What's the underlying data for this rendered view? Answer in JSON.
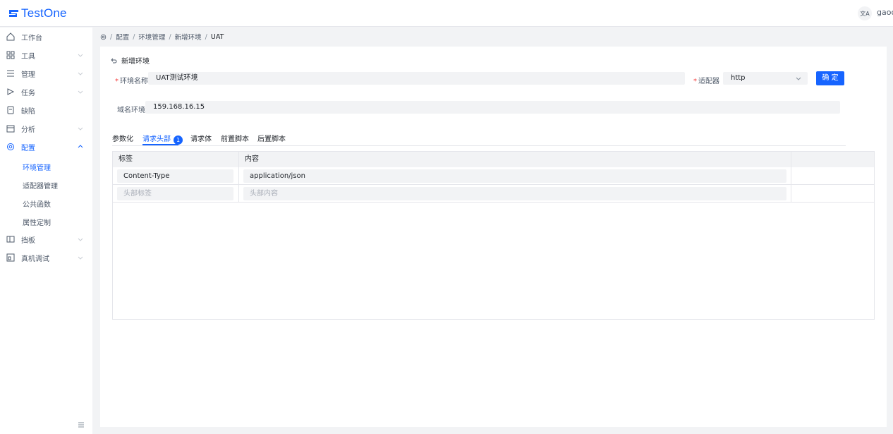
{
  "app": {
    "name": "TestOne",
    "user": "gaoc",
    "lang_icon": "translate-icon"
  },
  "sidebar": {
    "items": [
      {
        "label": "工作台",
        "icon": "home-icon"
      },
      {
        "label": "工具",
        "icon": "grid-icon"
      },
      {
        "label": "管理",
        "icon": "list-icon"
      },
      {
        "label": "任务",
        "icon": "play-icon"
      },
      {
        "label": "缺陷",
        "icon": "bug-icon"
      },
      {
        "label": "分析",
        "icon": "chart-icon"
      },
      {
        "label": "配置",
        "icon": "gear-icon"
      },
      {
        "label": "挡板",
        "icon": "panel-icon"
      },
      {
        "label": "真机调试",
        "icon": "device-icon"
      }
    ],
    "sub_items": [
      "环境管理",
      "适配器管理",
      "公共函数",
      "属性定制"
    ]
  },
  "breadcrumb": {
    "items": [
      "配置",
      "环境管理",
      "新增环境"
    ],
    "current": "UAT"
  },
  "form": {
    "header": "新增环境",
    "env_name_label": "环境名称",
    "env_name_value": "UAT测试环境",
    "adapter_label": "适配器",
    "adapter_value": "http",
    "confirm_label": "确 定",
    "domain_label": "域名环境",
    "domain_value": "159.168.16.15"
  },
  "tabs": {
    "items": [
      "参数化",
      "请求头部",
      "请求体",
      "前置脚本",
      "后置脚本"
    ],
    "active": "请求头部",
    "badge": "1"
  },
  "table": {
    "columns": [
      "标签",
      "内容"
    ],
    "rows": [
      {
        "key": "Content-Type",
        "value": "application/json"
      }
    ],
    "placeholder": {
      "key": "头部标签",
      "value": "头部内容"
    }
  },
  "colors": {
    "accent": "#1664ff",
    "required": "#f53f3f"
  }
}
